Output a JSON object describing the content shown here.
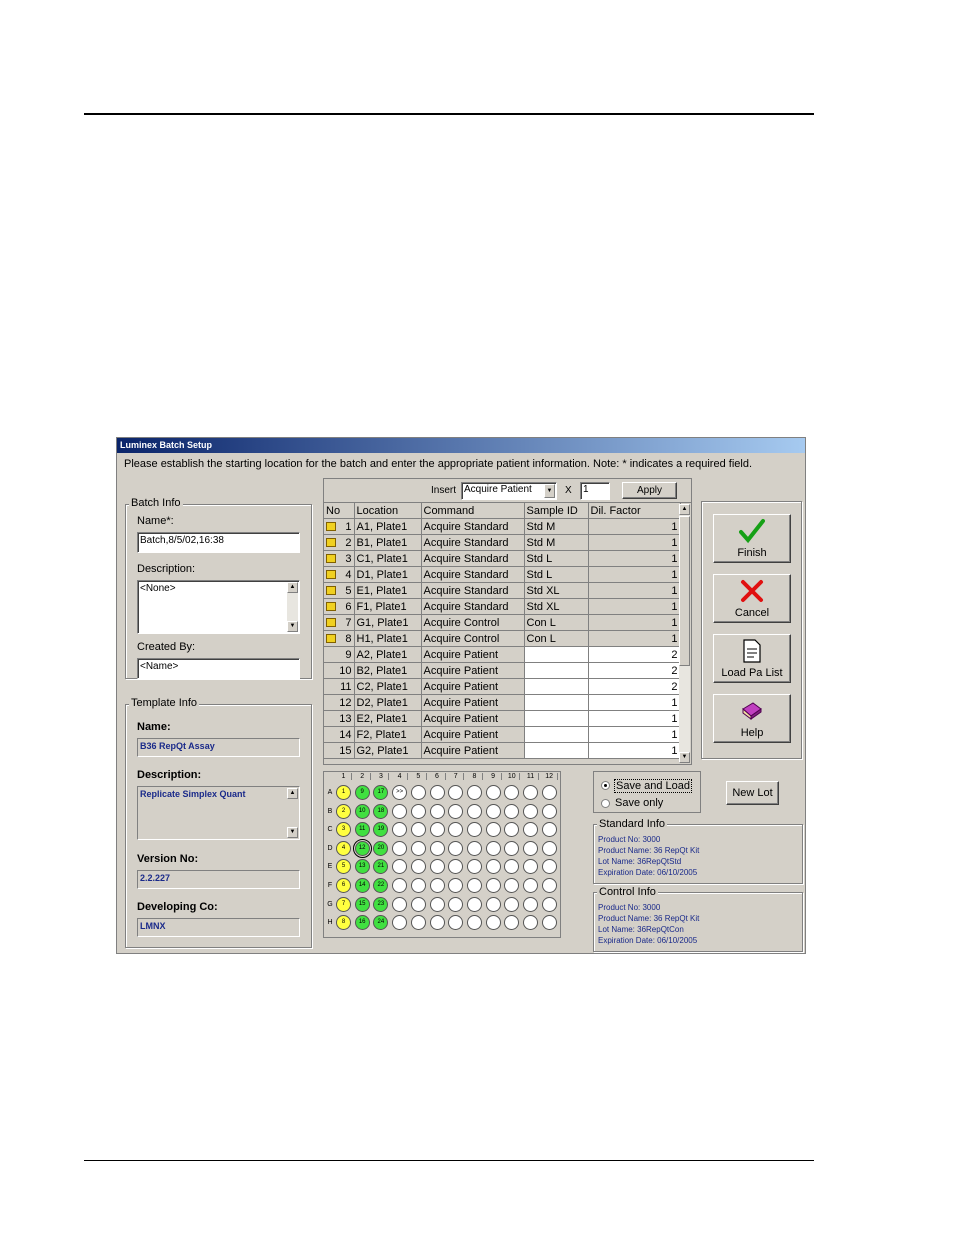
{
  "window": {
    "title": "Luminex Batch Setup",
    "instruction": "Please establish the starting location for the batch and enter the appropriate patient information.  Note: * indicates a required field."
  },
  "batch_info": {
    "legend": "Batch Info",
    "name_label": "Name*:",
    "name_value": "Batch,8/5/02,16:38",
    "description_label": "Description:",
    "description_value": "<None>",
    "created_by_label": "Created By:",
    "created_by_value": "<Name>"
  },
  "template_info": {
    "legend": "Template Info",
    "name_label": "Name:",
    "name_value": "B36 RepQt Assay",
    "description_label": "Description:",
    "description_value": "Replicate Simplex Quant",
    "version_label": "Version No:",
    "version_value": "2.2.227",
    "developer_label": "Developing Co:",
    "developer_value": "LMNX"
  },
  "insert_bar": {
    "label": "Insert",
    "command_value": "Acquire Patient",
    "times_label": "X",
    "count_value": "1",
    "apply_label": "Apply"
  },
  "table": {
    "headers": [
      "No",
      "Location",
      "Command",
      "Sample ID",
      "Dil. Factor"
    ],
    "rows": [
      {
        "no": "1",
        "location": "A1, Plate1",
        "command": "Acquire Standard",
        "sample_id": "Std M",
        "dil": "1",
        "locked": true
      },
      {
        "no": "2",
        "location": "B1, Plate1",
        "command": "Acquire Standard",
        "sample_id": "Std M",
        "dil": "1",
        "locked": true
      },
      {
        "no": "3",
        "location": "C1, Plate1",
        "command": "Acquire Standard",
        "sample_id": "Std L",
        "dil": "1",
        "locked": true
      },
      {
        "no": "4",
        "location": "D1, Plate1",
        "command": "Acquire Standard",
        "sample_id": "Std L",
        "dil": "1",
        "locked": true
      },
      {
        "no": "5",
        "location": "E1, Plate1",
        "command": "Acquire Standard",
        "sample_id": "Std XL",
        "dil": "1",
        "locked": true
      },
      {
        "no": "6",
        "location": "F1, Plate1",
        "command": "Acquire Standard",
        "sample_id": "Std XL",
        "dil": "1",
        "locked": true
      },
      {
        "no": "7",
        "location": "G1, Plate1",
        "command": "Acquire Control",
        "sample_id": "Con L",
        "dil": "1",
        "locked": true
      },
      {
        "no": "8",
        "location": "H1, Plate1",
        "command": "Acquire Control",
        "sample_id": "Con L",
        "dil": "1",
        "locked": true
      },
      {
        "no": "9",
        "location": "A2, Plate1",
        "command": "Acquire Patient",
        "sample_id": "",
        "dil": "2",
        "locked": false
      },
      {
        "no": "10",
        "location": "B2, Plate1",
        "command": "Acquire Patient",
        "sample_id": "",
        "dil": "2",
        "locked": false
      },
      {
        "no": "11",
        "location": "C2, Plate1",
        "command": "Acquire Patient",
        "sample_id": "",
        "dil": "2",
        "locked": false
      },
      {
        "no": "12",
        "location": "D2, Plate1",
        "command": "Acquire Patient",
        "sample_id": "",
        "dil": "1",
        "locked": false
      },
      {
        "no": "13",
        "location": "E2, Plate1",
        "command": "Acquire Patient",
        "sample_id": "",
        "dil": "1",
        "locked": false
      },
      {
        "no": "14",
        "location": "F2, Plate1",
        "command": "Acquire Patient",
        "sample_id": "",
        "dil": "1",
        "locked": false
      },
      {
        "no": "15",
        "location": "G2, Plate1",
        "command": "Acquire Patient",
        "sample_id": "",
        "dil": "1",
        "locked": false
      }
    ]
  },
  "buttons": {
    "finish": "Finish",
    "cancel": "Cancel",
    "load_pa_list": "Load Pa List",
    "help": "Help",
    "new_lot": "New Lot"
  },
  "save_options": {
    "save_and_load": "Save and Load",
    "save_only": "Save only",
    "selected": "save_and_load"
  },
  "plate": {
    "columns": [
      "1",
      "2",
      "3",
      "4",
      "5",
      "6",
      "7",
      "8",
      "9",
      "10",
      "11",
      "12"
    ],
    "rows": [
      "A",
      "B",
      "C",
      "D",
      "E",
      "F",
      "G",
      "H"
    ],
    "col1": [
      "1",
      "2",
      "3",
      "4",
      "5",
      "6",
      "7",
      "8"
    ],
    "col2": [
      "9",
      "10",
      "11",
      "12",
      "13",
      "14",
      "15",
      "16"
    ],
    "col3": [
      "17",
      "18",
      "19",
      "20",
      "21",
      "22",
      "23",
      "24"
    ],
    "next_marker": ">>",
    "colors": {
      "standard": "#ffff40",
      "patient": "#40e040",
      "empty": "#ffffff"
    }
  },
  "standard_info": {
    "legend": "Standard Info",
    "product_no": "Product No: 3000",
    "product_name": "Product Name: 36 RepQt Kit",
    "lot_name": "Lot Name: 36RepQtStd",
    "expiration": "Expiration Date: 06/10/2005"
  },
  "control_info": {
    "legend": "Control Info",
    "product_no": "Product No: 3000",
    "product_name": "Product Name: 36 RepQt Kit",
    "lot_name": "Lot Name: 36RepQtCon",
    "expiration": "Expiration Date: 06/10/2005"
  }
}
